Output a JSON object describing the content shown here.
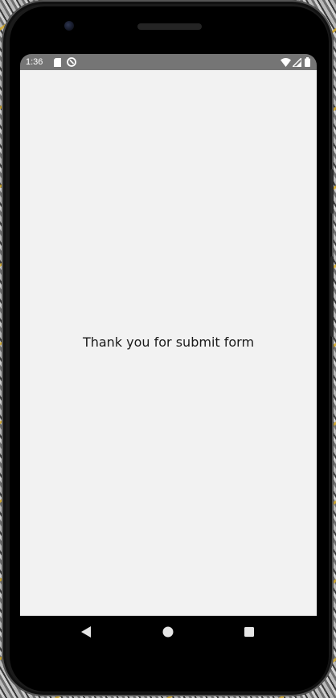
{
  "status_bar": {
    "time": "1:36",
    "icons": [
      "sd-card-icon",
      "sync-icon",
      "wifi-icon",
      "signal-icon",
      "battery-icon"
    ]
  },
  "screen": {
    "message": "Thank you for submit form",
    "background_color": "#f2f2f2"
  },
  "nav_bar": {
    "buttons": [
      "back-icon",
      "home-icon",
      "recents-icon"
    ]
  }
}
